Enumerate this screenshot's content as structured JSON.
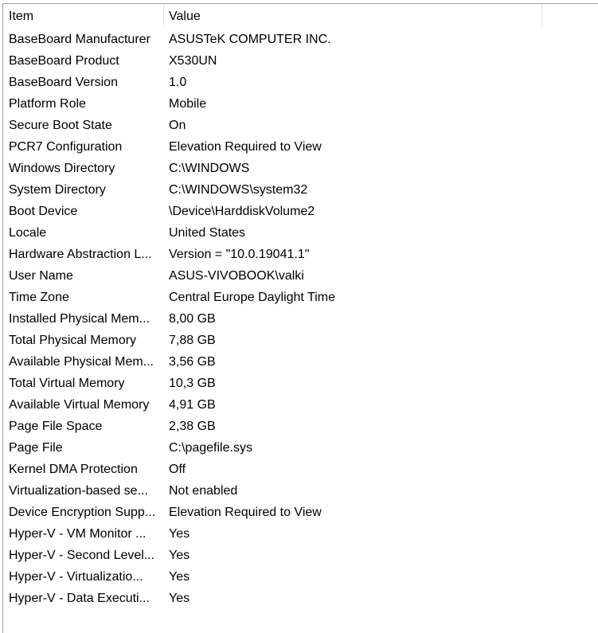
{
  "columns": {
    "item": "Item",
    "value": "Value"
  },
  "rows": [
    {
      "item": "BaseBoard Manufacturer",
      "value": "ASUSTeK COMPUTER INC."
    },
    {
      "item": "BaseBoard Product",
      "value": "X530UN"
    },
    {
      "item": "BaseBoard Version",
      "value": "1.0"
    },
    {
      "item": "Platform Role",
      "value": "Mobile"
    },
    {
      "item": "Secure Boot State",
      "value": "On"
    },
    {
      "item": "PCR7 Configuration",
      "value": "Elevation Required to View"
    },
    {
      "item": "Windows Directory",
      "value": "C:\\WINDOWS"
    },
    {
      "item": "System Directory",
      "value": "C:\\WINDOWS\\system32"
    },
    {
      "item": "Boot Device",
      "value": "\\Device\\HarddiskVolume2"
    },
    {
      "item": "Locale",
      "value": "United States"
    },
    {
      "item": "Hardware Abstraction L...",
      "value": "Version = \"10.0.19041.1\""
    },
    {
      "item": "User Name",
      "value": "ASUS-VIVOBOOK\\valki"
    },
    {
      "item": "Time Zone",
      "value": "Central Europe Daylight Time"
    },
    {
      "item": "Installed Physical Mem...",
      "value": "8,00 GB"
    },
    {
      "item": "Total Physical Memory",
      "value": "7,88 GB"
    },
    {
      "item": "Available Physical Mem...",
      "value": "3,56 GB"
    },
    {
      "item": "Total Virtual Memory",
      "value": "10,3 GB"
    },
    {
      "item": "Available Virtual Memory",
      "value": "4,91 GB"
    },
    {
      "item": "Page File Space",
      "value": "2,38 GB"
    },
    {
      "item": "Page File",
      "value": "C:\\pagefile.sys"
    },
    {
      "item": "Kernel DMA Protection",
      "value": "Off"
    },
    {
      "item": "Virtualization-based se...",
      "value": "Not enabled"
    },
    {
      "item": "Device Encryption Supp...",
      "value": "Elevation Required to View"
    },
    {
      "item": "Hyper-V - VM Monitor ...",
      "value": "Yes"
    },
    {
      "item": "Hyper-V - Second Level...",
      "value": "Yes"
    },
    {
      "item": "Hyper-V - Virtualizatio...",
      "value": "Yes"
    },
    {
      "item": "Hyper-V - Data Executi...",
      "value": "Yes"
    }
  ]
}
